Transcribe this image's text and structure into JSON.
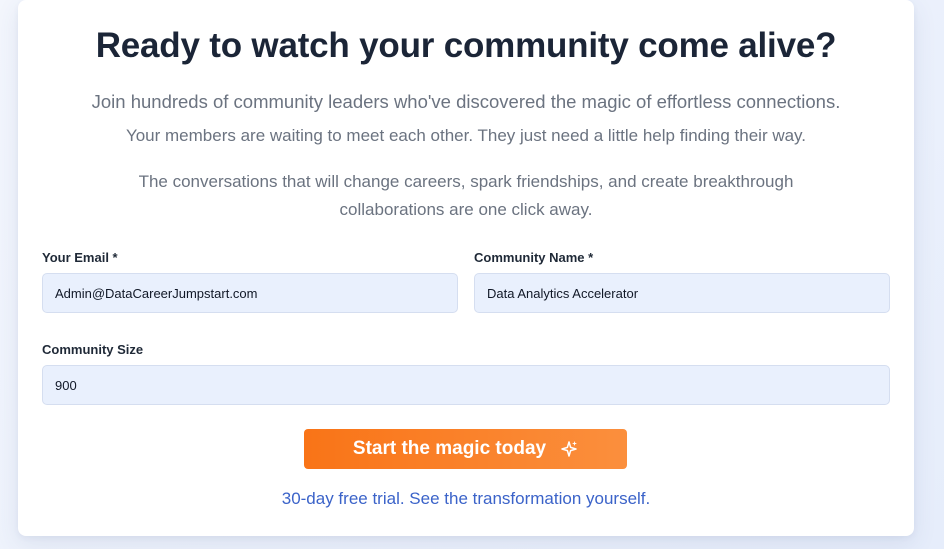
{
  "hero": {
    "title": "Ready to watch your community come alive?",
    "lead": "Join hundreds of community leaders who've discovered the magic of effortless connections.",
    "sub": "Your members are waiting to meet each other. They just need a little help finding their way.",
    "paragraph": "The conversations that will change careers, spark friendships, and create breakthrough collaborations are one click away."
  },
  "form": {
    "email_label": "Your Email *",
    "email_value": "Admin@DataCareerJumpstart.com",
    "community_label": "Community Name *",
    "community_value": "Data Analytics Accelerator",
    "size_label": "Community Size",
    "size_value": "900",
    "submit_label": "Start the magic today",
    "submit_icon": "sparkles-icon"
  },
  "footer": {
    "trial_text": "30-day free trial. See the transformation yourself."
  },
  "colors": {
    "accent": "#f97417",
    "link": "#3b63c9",
    "input_bg": "#e9f0fd"
  }
}
